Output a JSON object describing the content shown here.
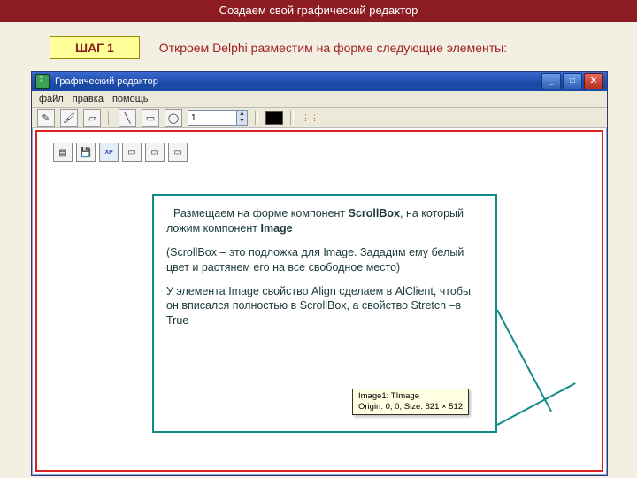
{
  "header": {
    "title": "Создаем свой графический редактор"
  },
  "step": {
    "badge": "ШАГ 1",
    "text": "Откроем Delphi разместим на форме следующие элементы:"
  },
  "window": {
    "title": "Графический редактор",
    "btn_min": "_",
    "btn_max": "□",
    "btn_close": "X",
    "menu": {
      "file": "файл",
      "edit": "правка",
      "help": "помощь"
    },
    "tool_pencil": "✎",
    "tool_brush": "🖌",
    "tool_eraser": "▱",
    "tool_line": "╲",
    "tool_rect": "▭",
    "tool_ellipse": "◯",
    "spin_value": "1",
    "spin_up": "▲",
    "spin_down": "▼",
    "swatch_color": "#000000",
    "dots": "⋮⋮"
  },
  "palette": {
    "b1": "▤",
    "b2": "💾",
    "b3_xp": "XP",
    "b4": "▭",
    "b5": "▭",
    "b6": "▭"
  },
  "note": {
    "p1a": "Размещаем на форме компонент ",
    "p1b_strong": "ScrollBox",
    "p1c": ", на который ложим компонент ",
    "p1d_strong": "Image",
    "p2": "(ScrollBox – это подложка для Image. Зададим ему белый цвет и растянем его на все свободное место)",
    "p3": "У элемента Image свойство Align сделаем в AlClient, чтобы он вписался полностью в ScrollBox, а свойство Stretch –в True"
  },
  "tooltip": {
    "line1": "Image1: TImage",
    "line2": "Origin: 0, 0; Size: 821 × 512"
  }
}
